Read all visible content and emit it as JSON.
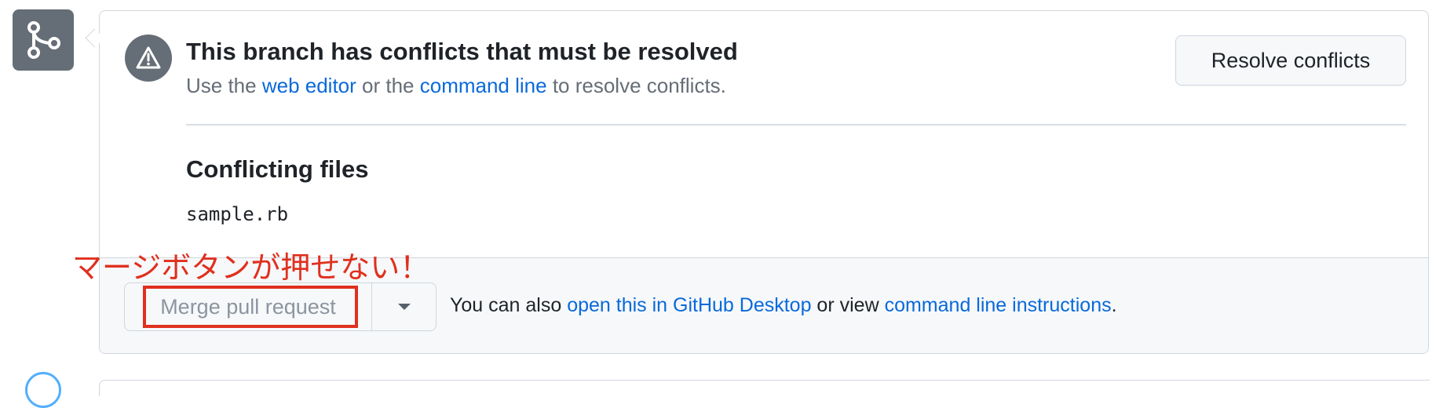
{
  "conflict": {
    "title": "This branch has conflicts that must be resolved",
    "desc_prefix": "Use the ",
    "web_editor_link": "web editor",
    "desc_middle": " or the ",
    "command_line_link": "command line",
    "desc_suffix": " to resolve conflicts.",
    "resolve_button": "Resolve conflicts"
  },
  "conflicting_files": {
    "title": "Conflicting files",
    "files": [
      "sample.rb"
    ]
  },
  "merge": {
    "button_label": "Merge pull request",
    "button_state": "disabled",
    "footer_prefix": "You can also ",
    "desktop_link": "open this in GitHub Desktop",
    "footer_middle": " or view ",
    "instructions_link": "command line instructions",
    "footer_suffix": "."
  },
  "annotation": {
    "text": "マージボタンが押せない！",
    "color": "#e0301e"
  },
  "icons": {
    "branch": "git-branch-icon",
    "alert": "alert-triangle-icon",
    "dropdown": "triangle-down-icon"
  },
  "colors": {
    "link": "#0969da",
    "icon_bg": "#656d76",
    "footer_bg": "#f6f8fa",
    "border": "#d0d7de"
  }
}
